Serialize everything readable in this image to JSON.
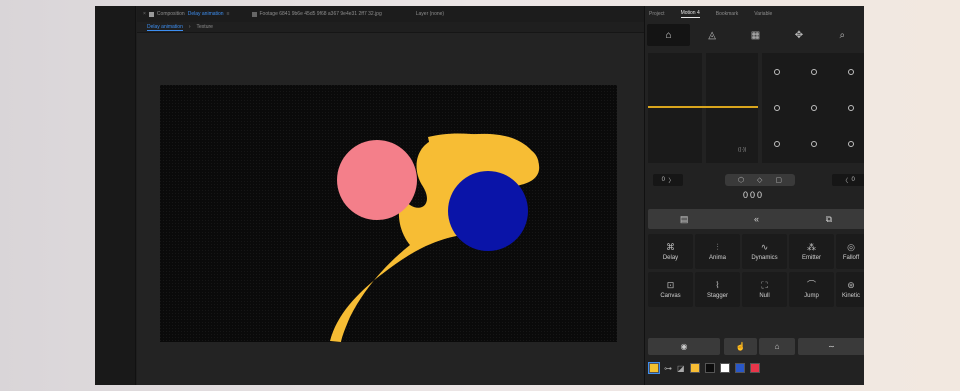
{
  "composition_panel": {
    "title": "Composition",
    "comp_name": "Delay animation",
    "footage": "Footage 6841 9b6e 45d5 9f68 a367 9e4e31 2ff7 32.jpg",
    "layer": "Layer (none)",
    "tabs": [
      "Delay animation",
      "Texture"
    ]
  },
  "canvas": {
    "background": "#0a0a0a",
    "shapes": [
      {
        "name": "pink-circle",
        "color": "#f47f8a"
      },
      {
        "name": "blue-circle",
        "color": "#0a14a8"
      },
      {
        "name": "yellow-blob",
        "color": "#f7bd34"
      }
    ]
  },
  "right_panel": {
    "tabs": [
      "Project",
      "Motion 4",
      "Bookmark",
      "Variable"
    ],
    "active_tab": "Motion 4",
    "tool_icons": [
      "home-icon",
      "drop-icon",
      "grid-icon",
      "move-icon",
      "search-icon"
    ],
    "graph_label": "((·))",
    "left_value": "0",
    "right_value": "0",
    "ease_number": "000",
    "section_icons": [
      "layer-icon",
      "rewind-icon",
      "link-icon"
    ],
    "tools": [
      {
        "label": "Delay",
        "icon": "⌘"
      },
      {
        "label": "Anima",
        "icon": "⫶"
      },
      {
        "label": "Dynamics",
        "icon": "∿"
      },
      {
        "label": "Emitter",
        "icon": "⁂"
      },
      {
        "label": "Falloff",
        "icon": "◎"
      },
      {
        "label": "Canvas",
        "icon": "⊡"
      },
      {
        "label": "Stagger",
        "icon": "⌇"
      },
      {
        "label": "Null",
        "icon": "⛶"
      },
      {
        "label": "Jump",
        "icon": "⌒"
      },
      {
        "label": "Kinetic",
        "icon": "⊛"
      }
    ],
    "bottom_icons": [
      "eye-icon",
      "touch-icon",
      "house-icon",
      "curve-icon"
    ],
    "swatches": [
      "#f2c12e",
      "#f7bd34",
      "#0c0c0c",
      "#ffffff",
      "#2957c8",
      "#e8364a"
    ],
    "accent": "#3d8ef0",
    "graph_color": "#d9a51d"
  }
}
